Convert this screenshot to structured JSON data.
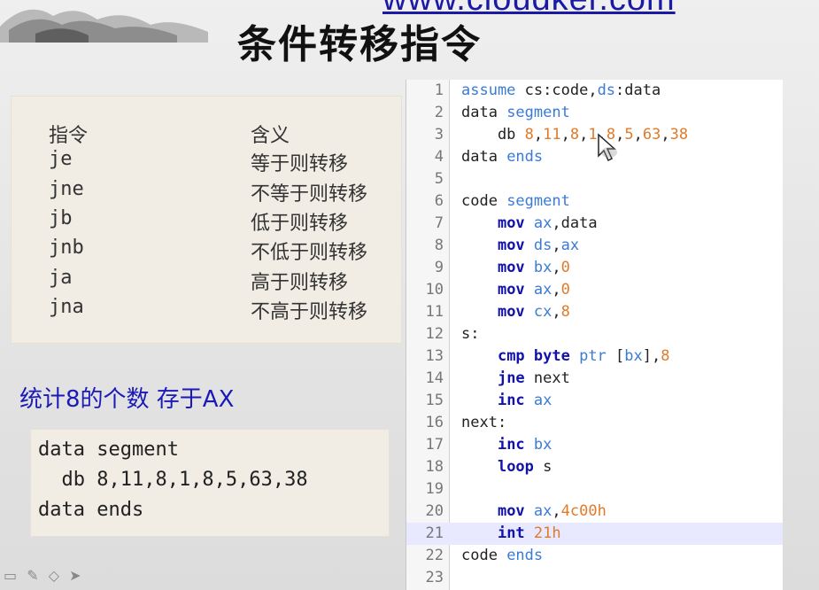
{
  "header": {
    "url": "www.cloudker.com",
    "title": "条件转移指令"
  },
  "table": {
    "header": {
      "instr": "指令",
      "meaning": "含义"
    },
    "rows": [
      {
        "instr": "je",
        "meaning": "等于则转移"
      },
      {
        "instr": "jne",
        "meaning": "不等于则转移"
      },
      {
        "instr": "jb",
        "meaning": "低于则转移"
      },
      {
        "instr": "jnb",
        "meaning": "不低于则转移"
      },
      {
        "instr": "ja",
        "meaning": "高于则转移"
      },
      {
        "instr": "jna",
        "meaning": "不高于则转移"
      }
    ]
  },
  "caption": "统计8的个数 存于AX",
  "data_snippet": [
    "data segment",
    "  db 8,11,8,1,8,5,63,38",
    "data ends"
  ],
  "code": {
    "active_line": 21,
    "lines": [
      [
        [
          "kw",
          "assume "
        ],
        [
          "txt",
          "cs"
        ],
        [
          "txt",
          ":code,"
        ],
        [
          "kw",
          "ds"
        ],
        [
          "txt",
          ":data"
        ]
      ],
      [
        [
          "txt",
          "data "
        ],
        [
          "kw",
          "segment"
        ]
      ],
      [
        [
          "txt",
          "    db "
        ],
        [
          "num",
          "8"
        ],
        [
          "txt",
          ","
        ],
        [
          "num",
          "11"
        ],
        [
          "txt",
          ","
        ],
        [
          "num",
          "8"
        ],
        [
          "txt",
          ","
        ],
        [
          "num",
          "1"
        ],
        [
          "txt",
          ","
        ],
        [
          "num",
          "8"
        ],
        [
          "txt",
          ","
        ],
        [
          "num",
          "5"
        ],
        [
          "txt",
          ","
        ],
        [
          "num",
          "63"
        ],
        [
          "txt",
          ","
        ],
        [
          "num",
          "38"
        ]
      ],
      [
        [
          "txt",
          "data "
        ],
        [
          "kw",
          "ends"
        ]
      ],
      [],
      [
        [
          "txt",
          "code "
        ],
        [
          "kw",
          "segment"
        ]
      ],
      [
        [
          "txt",
          "    "
        ],
        [
          "ins",
          "mov "
        ],
        [
          "kw",
          "ax"
        ],
        [
          "txt",
          ",data"
        ]
      ],
      [
        [
          "txt",
          "    "
        ],
        [
          "ins",
          "mov "
        ],
        [
          "kw",
          "ds"
        ],
        [
          "txt",
          ","
        ],
        [
          "kw",
          "ax"
        ]
      ],
      [
        [
          "txt",
          "    "
        ],
        [
          "ins",
          "mov "
        ],
        [
          "kw",
          "bx"
        ],
        [
          "txt",
          ","
        ],
        [
          "num",
          "0"
        ]
      ],
      [
        [
          "txt",
          "    "
        ],
        [
          "ins",
          "mov "
        ],
        [
          "kw",
          "ax"
        ],
        [
          "txt",
          ","
        ],
        [
          "num",
          "0"
        ]
      ],
      [
        [
          "txt",
          "    "
        ],
        [
          "ins",
          "mov "
        ],
        [
          "kw",
          "cx"
        ],
        [
          "txt",
          ","
        ],
        [
          "num",
          "8"
        ]
      ],
      [
        [
          "txt",
          "s:"
        ]
      ],
      [
        [
          "txt",
          "    "
        ],
        [
          "ins",
          "cmp byte "
        ],
        [
          "kw",
          "ptr "
        ],
        [
          "txt",
          "["
        ],
        [
          "kw",
          "bx"
        ],
        [
          "txt",
          "],"
        ],
        [
          "num",
          "8"
        ]
      ],
      [
        [
          "txt",
          "    "
        ],
        [
          "ins",
          "jne "
        ],
        [
          "txt",
          "next"
        ]
      ],
      [
        [
          "txt",
          "    "
        ],
        [
          "ins",
          "inc "
        ],
        [
          "kw",
          "ax"
        ]
      ],
      [
        [
          "txt",
          "next:"
        ]
      ],
      [
        [
          "txt",
          "    "
        ],
        [
          "ins",
          "inc "
        ],
        [
          "kw",
          "bx"
        ]
      ],
      [
        [
          "txt",
          "    "
        ],
        [
          "ins",
          "loop "
        ],
        [
          "txt",
          "s"
        ]
      ],
      [],
      [
        [
          "txt",
          "    "
        ],
        [
          "ins",
          "mov "
        ],
        [
          "kw",
          "ax"
        ],
        [
          "txt",
          ","
        ],
        [
          "num",
          "4c00h"
        ]
      ],
      [
        [
          "txt",
          "    "
        ],
        [
          "ins",
          "int "
        ],
        [
          "num",
          "21h"
        ]
      ],
      [
        [
          "txt",
          "code "
        ],
        [
          "kw",
          "ends"
        ]
      ],
      []
    ]
  },
  "toolbar_icons": [
    "slides-icon",
    "pen-icon",
    "eraser-icon",
    "pointer-icon"
  ]
}
